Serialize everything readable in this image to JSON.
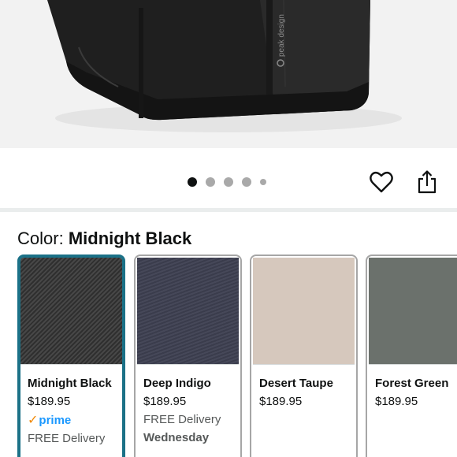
{
  "gallery": {
    "image_count": 5,
    "active_index": 0,
    "brand_mark_text": "peak design"
  },
  "color_selector": {
    "label": "Color:",
    "selected_value": "Midnight Black",
    "options": [
      {
        "name": "Midnight Black",
        "price": "$189.95",
        "prime_label": "prime",
        "delivery": "FREE Delivery",
        "swatch_color": "#3a3a3a",
        "selected": true
      },
      {
        "name": "Deep Indigo",
        "price": "$189.95",
        "delivery": "FREE Delivery",
        "delivery_day": "Wednesday",
        "swatch_color": "#3f4152",
        "selected": false
      },
      {
        "name": "Desert Taupe",
        "price": "$189.95",
        "swatch_color": "#d6c8bd",
        "selected": false
      },
      {
        "name": "Forest Green",
        "price": "$189.95",
        "swatch_color": "#6b716c",
        "selected": false
      }
    ]
  },
  "colors": {
    "accent_selected_border": "#1b7187",
    "prime_blue": "#1a98ff",
    "prime_check": "#f08804"
  },
  "icons": {
    "wishlist": "heart-icon",
    "share": "share-icon"
  }
}
